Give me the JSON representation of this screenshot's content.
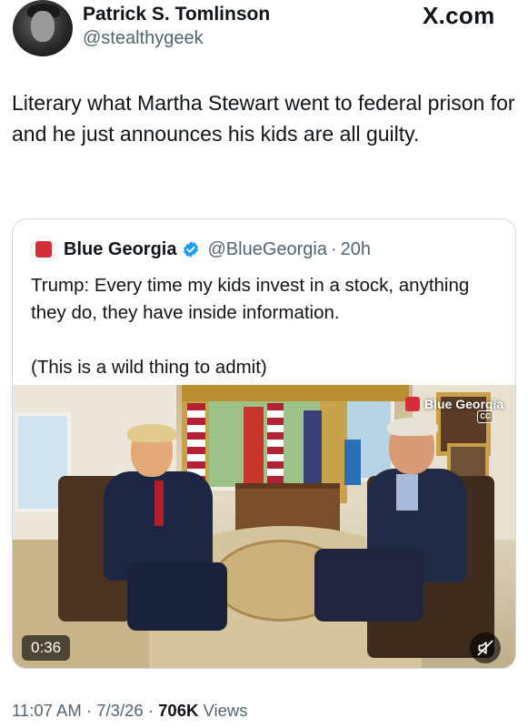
{
  "author": {
    "name": "Patrick S. Tomlinson",
    "handle": "@stealthygeek"
  },
  "source_logo": "X.com",
  "tweet_text": "Literary what Martha Stewart went to federal prison for and he just announces his kids are all guilty.",
  "quoted_tweet": {
    "name": "Blue Georgia",
    "handle": "@BlueGeorgia",
    "separator": "·",
    "age": "20h",
    "text_line1": "Trump: Every time my kids invest in a stock, anything they do, they have inside information.",
    "text_line2": "(This is a wild thing to admit)",
    "video": {
      "overlay_label": "Blue Georgia",
      "cc_label": "CC",
      "duration": "0:36"
    }
  },
  "meta": {
    "time": "11:07 AM",
    "separator": "·",
    "date": "7/3/26",
    "views_count": "706K",
    "views_label": "Views"
  },
  "colors": {
    "primary_text": "#0f1419",
    "secondary_text": "#536471",
    "border": "#cfd9de",
    "verified": "#1d9bf0",
    "brand_red": "#d42e3b"
  }
}
